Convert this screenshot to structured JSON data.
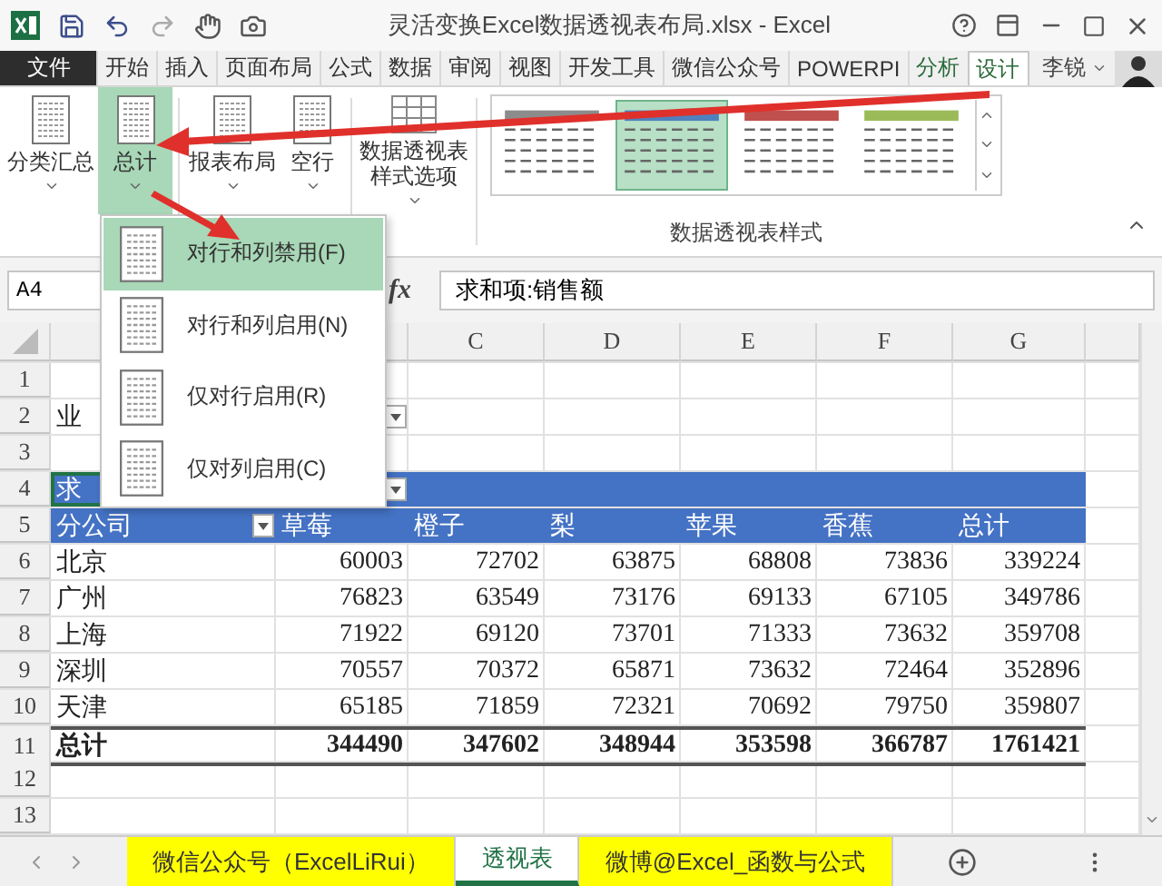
{
  "window": {
    "title": "灵活变换Excel数据透视表布局.xlsx - Excel"
  },
  "ribbon_tabs": [
    {
      "label": "文件",
      "kind": "file",
      "selected": false
    },
    {
      "label": "开始",
      "kind": "tab",
      "selected": false
    },
    {
      "label": "插入",
      "kind": "tab",
      "selected": false
    },
    {
      "label": "页面布局",
      "kind": "tab",
      "selected": false
    },
    {
      "label": "公式",
      "kind": "tab",
      "selected": false
    },
    {
      "label": "数据",
      "kind": "tab",
      "selected": false
    },
    {
      "label": "审阅",
      "kind": "tab",
      "selected": false
    },
    {
      "label": "视图",
      "kind": "tab",
      "selected": false
    },
    {
      "label": "开发工具",
      "kind": "tab",
      "selected": false
    },
    {
      "label": "微信公众号",
      "kind": "tab",
      "selected": false
    },
    {
      "label": "POWERPI",
      "kind": "tab",
      "selected": false
    },
    {
      "label": "分析",
      "kind": "context",
      "selected": false
    },
    {
      "label": "设计",
      "kind": "context",
      "selected": true
    }
  ],
  "user": {
    "name": "李锐"
  },
  "ribbon_buttons": [
    {
      "label": "分类汇总",
      "selected": false
    },
    {
      "label": "总计",
      "selected": true
    },
    {
      "label": "报表布局",
      "selected": false
    },
    {
      "label": "空行",
      "selected": false
    },
    {
      "label": "数据透视表样式选项",
      "selected": false
    }
  ],
  "style_gallery": {
    "label": "数据透视表样式",
    "styles": [
      {
        "color": "#8c8c8c",
        "selected": false
      },
      {
        "color": "#4f81bd",
        "selected": true
      },
      {
        "color": "#c0504d",
        "selected": false
      },
      {
        "color": "#9bbb59",
        "selected": false
      }
    ]
  },
  "menu": {
    "items": [
      {
        "label": "对行和列禁用(F)",
        "selected": true
      },
      {
        "label": "对行和列启用(N)",
        "selected": false
      },
      {
        "label": "仅对行启用(R)",
        "selected": false
      },
      {
        "label": "仅对列启用(C)",
        "selected": false
      }
    ]
  },
  "formula_bar": {
    "name_box": "A4",
    "function_label": "fx",
    "formula": "求和项:销售额"
  },
  "sheet": {
    "columns": [
      {},
      {},
      {
        "label": "C"
      },
      {
        "label": "D"
      },
      {
        "label": "E"
      },
      {
        "label": "F"
      },
      {
        "label": "G"
      }
    ],
    "rows": [
      {
        "number": "1",
        "kind": "blank",
        "cells": []
      },
      {
        "number": "2",
        "kind": "filter",
        "cells": [
          "业"
        ]
      },
      {
        "number": "3",
        "kind": "blank",
        "cells": []
      },
      {
        "number": "4",
        "kind": "pivot_title",
        "cells": [
          "求"
        ]
      },
      {
        "number": "5",
        "kind": "pivot_header",
        "cells": [
          "分公司",
          "草莓",
          "橙子",
          "梨",
          "苹果",
          "香蕉",
          "总计"
        ]
      },
      {
        "number": "6",
        "kind": "data",
        "cells": [
          "北京",
          "60003",
          "72702",
          "63875",
          "68808",
          "73836",
          "339224"
        ]
      },
      {
        "number": "7",
        "kind": "data",
        "cells": [
          "广州",
          "76823",
          "63549",
          "73176",
          "69133",
          "67105",
          "349786"
        ]
      },
      {
        "number": "8",
        "kind": "data",
        "cells": [
          "上海",
          "71922",
          "69120",
          "73701",
          "71333",
          "73632",
          "359708"
        ]
      },
      {
        "number": "9",
        "kind": "data",
        "cells": [
          "深圳",
          "70557",
          "70372",
          "65871",
          "73632",
          "72464",
          "352896"
        ]
      },
      {
        "number": "10",
        "kind": "data",
        "cells": [
          "天津",
          "65185",
          "71859",
          "72321",
          "70692",
          "79750",
          "359807"
        ]
      },
      {
        "number": "11",
        "kind": "total",
        "cells": [
          "总计",
          "344490",
          "347602",
          "348944",
          "353598",
          "366787",
          "1761421"
        ]
      },
      {
        "number": "12",
        "kind": "blank",
        "cells": []
      },
      {
        "number": "13",
        "kind": "blank",
        "cells": []
      }
    ]
  },
  "sheet_tabs": [
    {
      "label": "微信公众号（ExcelLiRui）",
      "selected": false,
      "color": "#ffff00"
    },
    {
      "label": "透视表",
      "selected": true,
      "color": "#ffffff"
    },
    {
      "label": "微博@Excel_函数与公式",
      "selected": false,
      "color": "#ffff00"
    }
  ]
}
